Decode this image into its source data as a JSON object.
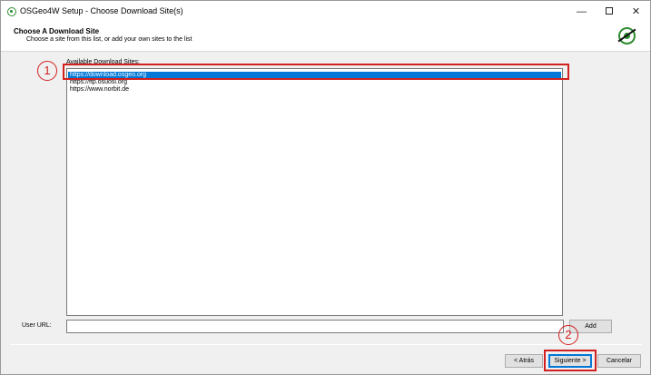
{
  "window": {
    "title": "OSGeo4W Setup - Choose Download Site(s)",
    "controls": {
      "minimize": "—",
      "close": "✕"
    }
  },
  "header": {
    "title": "Choose A Download Site",
    "subtitle": "Choose a site from this list, or add your own sites to the list",
    "logo_icon": "osgeo-logo-icon"
  },
  "sites": {
    "label": "Available Download Sites:",
    "items": [
      {
        "url": "https://download.osgeo.org",
        "selected": true
      },
      {
        "url": "https://ftp.osuosl.org",
        "selected": false
      },
      {
        "url": "https://www.norbit.de",
        "selected": false
      }
    ]
  },
  "user_url": {
    "label": "User URL:",
    "value": "",
    "placeholder": "",
    "add_label": "Add"
  },
  "footer": {
    "back_label": "< Atrás",
    "next_label": "Siguiente >",
    "cancel_label": "Cancelar"
  },
  "annotations": {
    "marker_1": "1",
    "marker_2": "2",
    "color": "#d21f1f"
  },
  "colors": {
    "selection": "#0078d7",
    "accent_green": "#2e8b2e"
  }
}
